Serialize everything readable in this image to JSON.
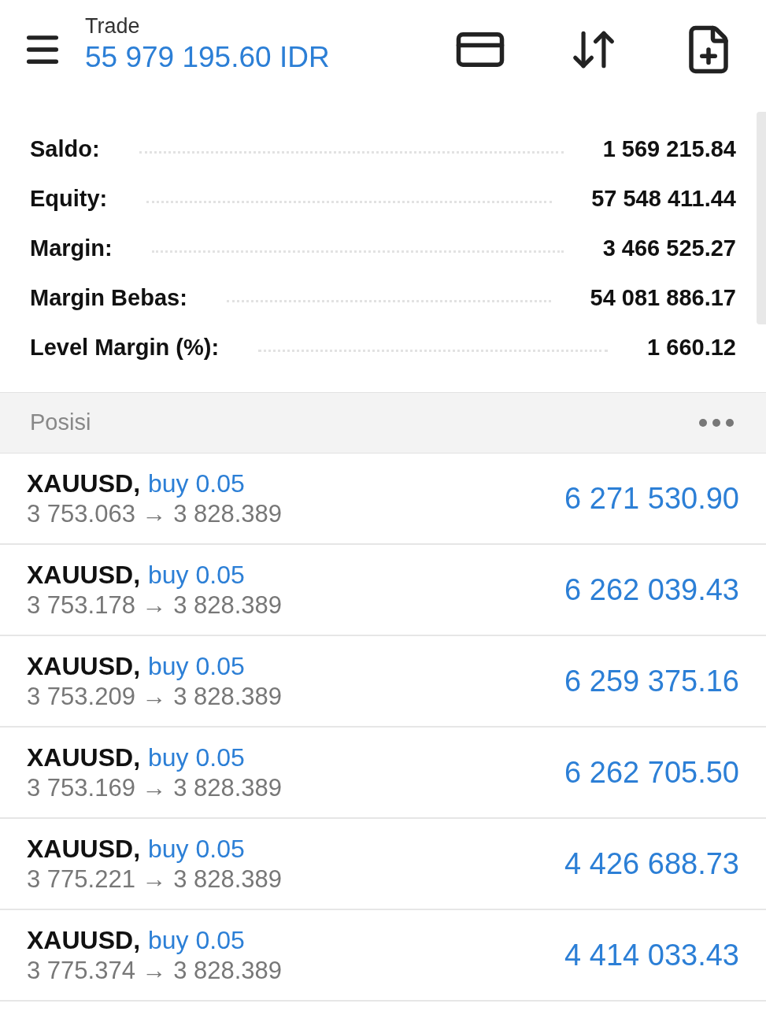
{
  "header": {
    "title": "Trade",
    "balance": "55 979 195.60 IDR"
  },
  "summary": [
    {
      "label": "Saldo:",
      "value": "1 569 215.84"
    },
    {
      "label": "Equity:",
      "value": "57 548 411.44"
    },
    {
      "label": "Margin:",
      "value": "3 466 525.27"
    },
    {
      "label": "Margin Bebas:",
      "value": "54 081 886.17"
    },
    {
      "label": "Level Margin (%):",
      "value": "1 660.12"
    }
  ],
  "positions_section": {
    "title": "Posisi"
  },
  "positions": [
    {
      "symbol": "XAUUSD,",
      "side": "buy 0.05",
      "prices": "3 753.063 → 3 828.389",
      "profit": "6 271 530.90"
    },
    {
      "symbol": "XAUUSD,",
      "side": "buy 0.05",
      "prices": "3 753.178 → 3 828.389",
      "profit": "6 262 039.43"
    },
    {
      "symbol": "XAUUSD,",
      "side": "buy 0.05",
      "prices": "3 753.209 → 3 828.389",
      "profit": "6 259 375.16"
    },
    {
      "symbol": "XAUUSD,",
      "side": "buy 0.05",
      "prices": "3 753.169 → 3 828.389",
      "profit": "6 262 705.50"
    },
    {
      "symbol": "XAUUSD,",
      "side": "buy 0.05",
      "prices": "3 775.221 → 3 828.389",
      "profit": "4 426 688.73"
    },
    {
      "symbol": "XAUUSD,",
      "side": "buy 0.05",
      "prices": "3 775.374 → 3 828.389",
      "profit": "4 414 033.43"
    }
  ]
}
